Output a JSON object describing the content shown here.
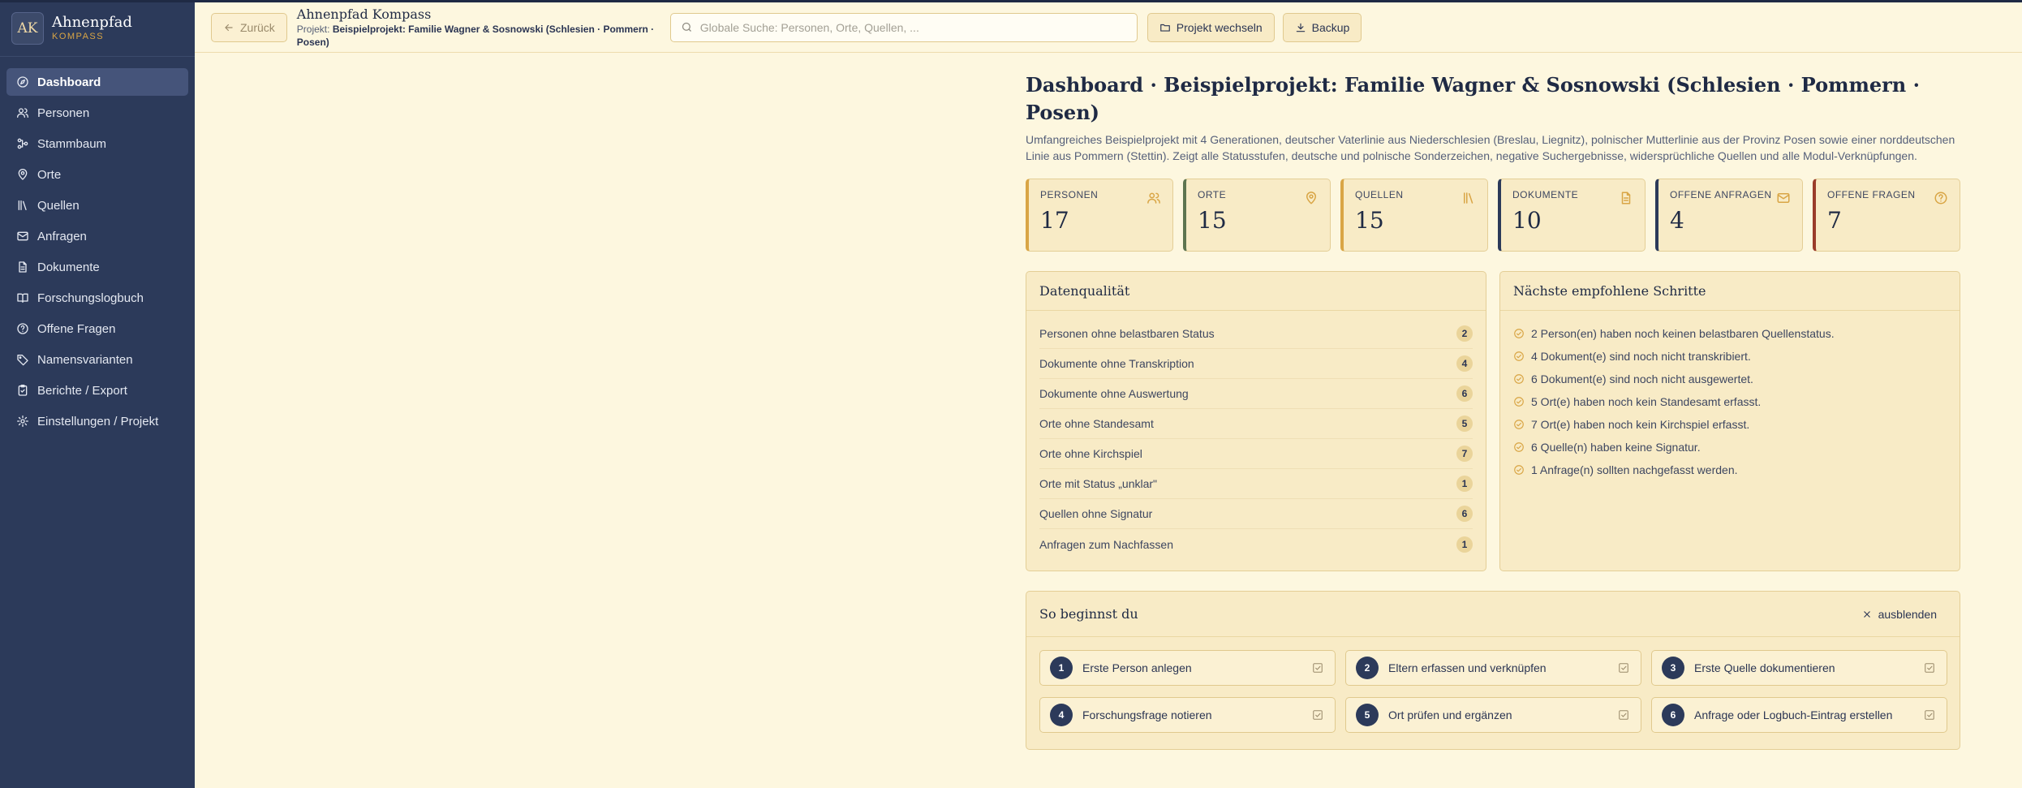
{
  "brand": {
    "logo": "AK",
    "name": "Ahnenpfad",
    "sub": "KOMPASS"
  },
  "nav": [
    {
      "label": "Dashboard",
      "icon": "compass-icon"
    },
    {
      "label": "Personen",
      "icon": "users-icon"
    },
    {
      "label": "Stammbaum",
      "icon": "tree-icon"
    },
    {
      "label": "Orte",
      "icon": "map-pin-icon"
    },
    {
      "label": "Quellen",
      "icon": "library-icon"
    },
    {
      "label": "Anfragen",
      "icon": "mail-icon"
    },
    {
      "label": "Dokumente",
      "icon": "document-icon"
    },
    {
      "label": "Forschungslogbuch",
      "icon": "book-icon"
    },
    {
      "label": "Offene Fragen",
      "icon": "help-circle-icon"
    },
    {
      "label": "Namensvarianten",
      "icon": "tag-icon"
    },
    {
      "label": "Berichte / Export",
      "icon": "clipboard-icon"
    },
    {
      "label": "Einstellungen / Projekt",
      "icon": "gear-icon"
    }
  ],
  "header": {
    "back_label": "Zurück",
    "app_title": "Ahnenpfad Kompass",
    "project_prefix": "Projekt:",
    "project_name": "Beispielprojekt: Familie Wagner & Sosnowski (Schlesien · Pommern · Posen)",
    "search_placeholder": "Globale Suche: Personen, Orte, Quellen, ...",
    "switch_label": "Projekt wechseln",
    "backup_label": "Backup"
  },
  "main": {
    "title": "Dashboard · Beispielprojekt: Familie Wagner & Sosnowski (Schlesien · Pommern · Posen)",
    "description": "Umfangreiches Beispielprojekt mit 4 Generationen, deutscher Vaterlinie aus Niederschlesien (Breslau, Liegnitz), polnischer Mutterlinie aus der Provinz Posen sowie einer norddeutschen Linie aus Pommern (Stettin). Zeigt alle Statusstufen, deutsche und polnische Sonderzeichen, negative Suchergebnisse, widersprüchliche Quellen und alle Modul-Verknüpfungen."
  },
  "stats": [
    {
      "label": "Personen",
      "value": "17",
      "icon": "users-icon",
      "accent": "#d9a545"
    },
    {
      "label": "Orte",
      "value": "15",
      "icon": "map-pin-icon",
      "accent": "#5e7550"
    },
    {
      "label": "Quellen",
      "value": "15",
      "icon": "library-icon",
      "accent": "#d9a545"
    },
    {
      "label": "Dokumente",
      "value": "10",
      "icon": "document-icon",
      "accent": "#2c3a5a"
    },
    {
      "label": "Offene Anfragen",
      "value": "4",
      "icon": "mail-icon",
      "accent": "#2c3a5a"
    },
    {
      "label": "Offene Fragen",
      "value": "7",
      "icon": "help-circle-icon",
      "accent": "#9a3c2a"
    }
  ],
  "data_quality": {
    "title": "Datenqualität",
    "rows": [
      {
        "label": "Personen ohne belastbaren Status",
        "count": "2"
      },
      {
        "label": "Dokumente ohne Transkription",
        "count": "4"
      },
      {
        "label": "Dokumente ohne Auswertung",
        "count": "6"
      },
      {
        "label": "Orte ohne Standesamt",
        "count": "5"
      },
      {
        "label": "Orte ohne Kirchspiel",
        "count": "7"
      },
      {
        "label": "Orte mit Status „unklar\"",
        "count": "1"
      },
      {
        "label": "Quellen ohne Signatur",
        "count": "6"
      },
      {
        "label": "Anfragen zum Nachfassen",
        "count": "1"
      }
    ]
  },
  "next_steps": {
    "title": "Nächste empfohlene Schritte",
    "items": [
      "2 Person(en) haben noch keinen belastbaren Quellenstatus.",
      "4 Dokument(e) sind noch nicht transkribiert.",
      "6 Dokument(e) sind noch nicht ausgewertet.",
      "5 Ort(e) haben noch kein Standesamt erfasst.",
      "7 Ort(e) haben noch kein Kirchspiel erfasst.",
      "6 Quelle(n) haben keine Signatur.",
      "1 Anfrage(n) sollten nachgefasst werden."
    ]
  },
  "getting_started": {
    "title": "So beginnst du",
    "hide_label": "ausblenden",
    "items": [
      {
        "num": "1",
        "label": "Erste Person anlegen"
      },
      {
        "num": "2",
        "label": "Eltern erfassen und verknüpfen"
      },
      {
        "num": "3",
        "label": "Erste Quelle dokumentieren"
      },
      {
        "num": "4",
        "label": "Forschungsfrage notieren"
      },
      {
        "num": "5",
        "label": "Ort prüfen und ergänzen"
      },
      {
        "num": "6",
        "label": "Anfrage oder Logbuch-Eintrag erstellen"
      }
    ]
  }
}
